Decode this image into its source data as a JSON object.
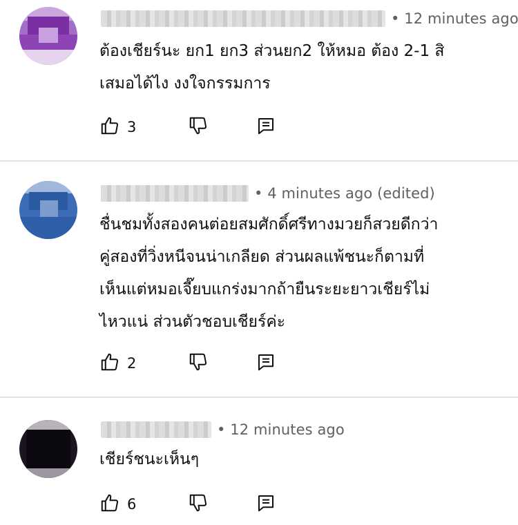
{
  "comments": [
    {
      "time": "• 12 minutes ago",
      "lines": [
        "ต้องเชียร์นะ ยก1 ยก3  ส่วนยก2 ให้หมอ ต้อง 2-1 สิ",
        "เสมอได้ไง  งงใจกรรมการ"
      ],
      "likes": "3",
      "avatar_color": "#8a3fb0"
    },
    {
      "time": "• 4 minutes ago (edited)",
      "lines": [
        "ชื่นชมทั้งสองคนต่อยสมศักดิ์ศรีทางมวยก็สวยดีกว่า",
        "คู่สองที่วิ่งหนีจนน่าเกลียด ส่วนผลแพ้ชนะก็ตามที่",
        "เห็นแต่หมอเจี๊ยบแกร่งมากถ้ายืนระยะยาวเชียร์ไม่",
        "ไหวแน่ ส่วนตัวชอบเชียร์ค่ะ"
      ],
      "likes": "2",
      "avatar_color": "#2f5fa8"
    },
    {
      "time": "• 12 minutes ago",
      "lines": [
        "เชียร์ชนะเห็นๆ"
      ],
      "likes": "6",
      "avatar_color": "#15111a"
    }
  ],
  "icons": {
    "like": "thumb-up-icon",
    "dislike": "thumb-down-icon",
    "reply": "reply-icon"
  }
}
